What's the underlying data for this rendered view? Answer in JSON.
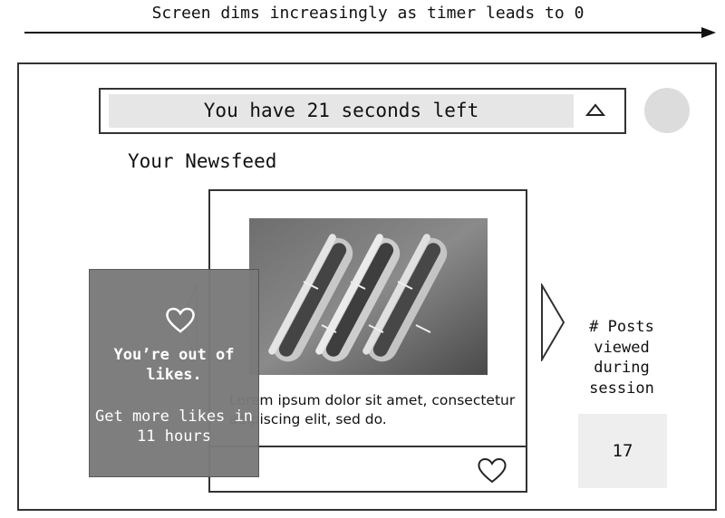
{
  "caption": "Screen dims increasingly as timer leads to 0",
  "timer": {
    "text": "You have 21 seconds left"
  },
  "feed": {
    "title": "Your Newsfeed"
  },
  "post": {
    "text": "Lorem ipsum dolor sit amet, consectetur adipiscing elit, sed do."
  },
  "overlay": {
    "title": "You’re out of likes.",
    "subtitle": "Get more likes in 11 hours"
  },
  "stats": {
    "label": "# Posts viewed during session",
    "count": "17"
  },
  "icons": {
    "timeline": "right-arrow-icon",
    "collapse": "chevron-up-icon",
    "like": "heart-icon",
    "next": "chevron-right-icon",
    "previous": "chevron-left-icon",
    "user": "avatar"
  },
  "colors": {
    "dim_overlay": "#7a7a7a",
    "timer_fill": "#e6e6e6",
    "counter_box": "#eeeeee"
  }
}
